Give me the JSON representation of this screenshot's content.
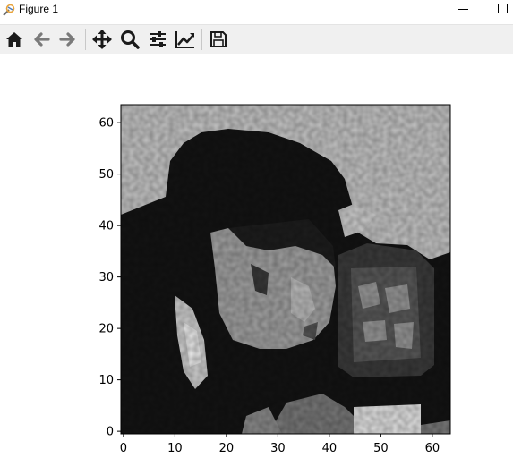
{
  "window": {
    "title": "Figure 1",
    "app_icon": "matplotlib-icon",
    "controls": [
      "minimize-icon",
      "maximize-icon"
    ]
  },
  "toolbar": {
    "buttons": [
      {
        "name": "home-button",
        "icon": "home-icon"
      },
      {
        "name": "back-button",
        "icon": "arrow-left-icon"
      },
      {
        "name": "forward-button",
        "icon": "arrow-right-icon"
      },
      {
        "name": "pan-button",
        "icon": "move-icon"
      },
      {
        "name": "zoom-button",
        "icon": "magnifier-icon"
      },
      {
        "name": "configure-subplots-button",
        "icon": "sliders-icon"
      },
      {
        "name": "edit-axes-button",
        "icon": "line-chart-icon"
      },
      {
        "name": "save-button",
        "icon": "floppy-disk-icon"
      }
    ]
  },
  "chart_data": {
    "type": "heatmap",
    "colormap": "gray",
    "content": "64x64 grayscale image: person with dark hair operating a camera on a tripod, sky background",
    "title": "",
    "xlabel": "",
    "ylabel": "",
    "xlim": [
      -0.5,
      63.5
    ],
    "ylim": [
      63.5,
      -0.5
    ],
    "xticks": [
      0,
      10,
      20,
      30,
      40,
      50,
      60
    ],
    "yticks": [
      0,
      10,
      20,
      30,
      40,
      50,
      60
    ],
    "grid": false,
    "legend": "none"
  }
}
